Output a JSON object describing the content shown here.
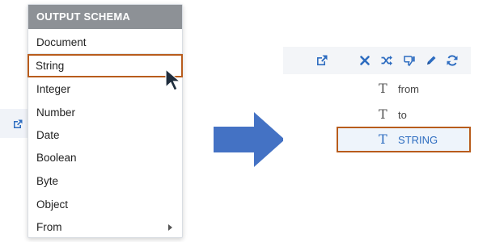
{
  "menu": {
    "header": "OUTPUT SCHEMA",
    "items": [
      {
        "label": "Document"
      },
      {
        "label": "String"
      },
      {
        "label": "Integer"
      },
      {
        "label": "Number"
      },
      {
        "label": "Date"
      },
      {
        "label": "Boolean"
      },
      {
        "label": "Byte"
      },
      {
        "label": "Object"
      },
      {
        "label": "From"
      }
    ],
    "highlighted": "String"
  },
  "tree": {
    "items": [
      {
        "label": "from",
        "type_glyph": "T"
      },
      {
        "label": "to",
        "type_glyph": "T"
      },
      {
        "label": "STRING",
        "type_glyph": "T"
      }
    ],
    "selected": "STRING"
  },
  "toolbar": {
    "icons": [
      "external-link-icon",
      "close-icon",
      "shuffle-icon",
      "thumbs-down-icon",
      "pencil-icon",
      "refresh-icon"
    ]
  },
  "colors": {
    "accent_blue": "#2d6cc0",
    "highlight_border": "#b85c1c",
    "menu_header_bg": "#8d9196",
    "arrow_blue": "#4472c4"
  }
}
